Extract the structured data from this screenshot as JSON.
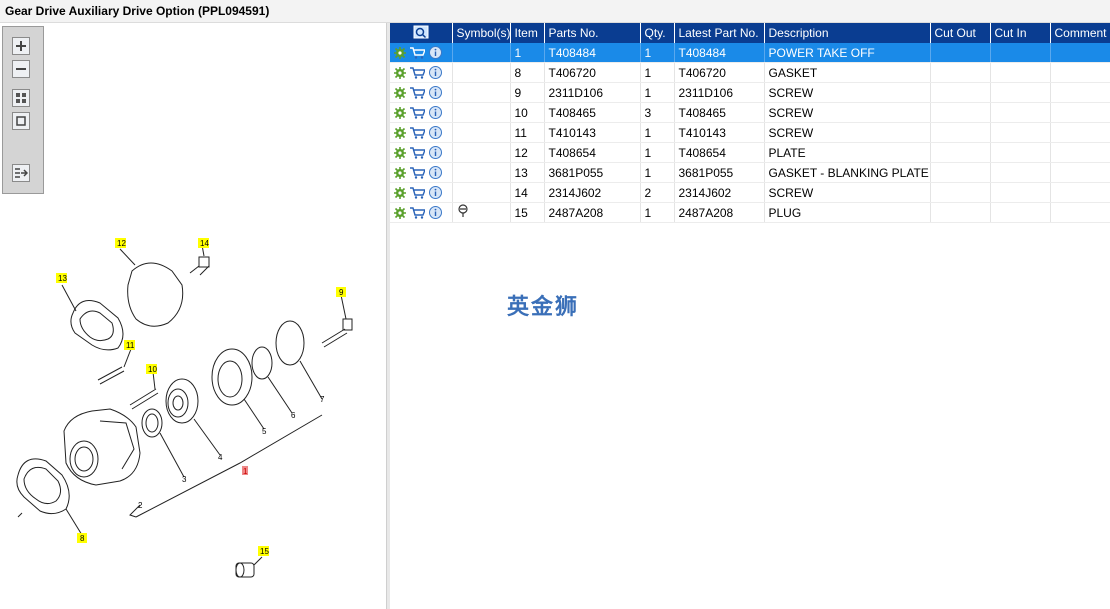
{
  "window": {
    "title": "Gear Drive Auxiliary Drive Option (PPL094591)"
  },
  "toolbar": {
    "buttons": [
      "zoom-in",
      "zoom-out",
      "fit-all",
      "fit-window",
      "export"
    ]
  },
  "diagram": {
    "callouts": [
      "12",
      "14",
      "13",
      "9",
      "11",
      "10",
      "8",
      "15",
      "1",
      "2",
      "3",
      "4",
      "5",
      "6",
      "7"
    ]
  },
  "table": {
    "headers": {
      "icons": "",
      "symbols": "Symbol(s)",
      "item": "Item",
      "parts_no": "Parts No.",
      "qty": "Qty.",
      "latest": "Latest Part No.",
      "description": "Description",
      "cut_out": "Cut Out",
      "cut_in": "Cut In",
      "comment": "Comment"
    },
    "rows": [
      {
        "item": "1",
        "parts_no": "T408484",
        "qty": "1",
        "latest": "T408484",
        "description": "POWER TAKE OFF",
        "selected": true,
        "symbol": ""
      },
      {
        "item": "8",
        "parts_no": "T406720",
        "qty": "1",
        "latest": "T406720",
        "description": "GASKET",
        "selected": false,
        "symbol": ""
      },
      {
        "item": "9",
        "parts_no": "2311D106",
        "qty": "1",
        "latest": "2311D106",
        "description": "SCREW",
        "selected": false,
        "symbol": ""
      },
      {
        "item": "10",
        "parts_no": "T408465",
        "qty": "3",
        "latest": "T408465",
        "description": "SCREW",
        "selected": false,
        "symbol": ""
      },
      {
        "item": "11",
        "parts_no": "T410143",
        "qty": "1",
        "latest": "T410143",
        "description": "SCREW",
        "selected": false,
        "symbol": ""
      },
      {
        "item": "12",
        "parts_no": "T408654",
        "qty": "1",
        "latest": "T408654",
        "description": "PLATE",
        "selected": false,
        "symbol": ""
      },
      {
        "item": "13",
        "parts_no": "3681P055",
        "qty": "1",
        "latest": "3681P055",
        "description": "GASKET - BLANKING PLATE",
        "selected": false,
        "symbol": ""
      },
      {
        "item": "14",
        "parts_no": "2314J602",
        "qty": "2",
        "latest": "2314J602",
        "description": "SCREW",
        "selected": false,
        "symbol": ""
      },
      {
        "item": "15",
        "parts_no": "2487A208",
        "qty": "1",
        "latest": "2487A208",
        "description": "PLUG",
        "selected": false,
        "symbol": "pin-icon"
      }
    ]
  },
  "watermark": "英金狮",
  "colors": {
    "header_bg": "#0a3d91",
    "selected_row": "#1a8ae8",
    "callout_yellow": "#ffff00"
  }
}
